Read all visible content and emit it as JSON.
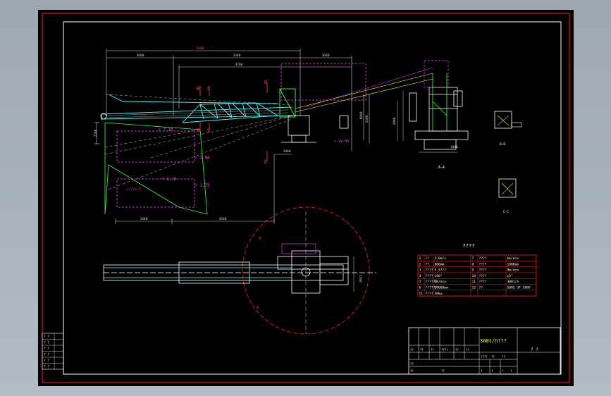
{
  "colors": {
    "frame": "#ff2020",
    "outline": "#ffffff",
    "structure": "#40ffff",
    "dimension": "#d0d0d0",
    "zone_magenta": "#ff40ff",
    "zone_green": "#40ff40",
    "annotation": "#ffff00",
    "table_text": "#ffffff"
  },
  "side_view": {
    "dims": {
      "total_top": "5800",
      "left_top": "3000",
      "mid_top": "3300",
      "right_top": "3000",
      "inner": "4700",
      "base_left": "3400",
      "base_right": "4500",
      "small_right": "1000",
      "vertical_left": "2500",
      "vertical_mid": "8000",
      "vertical_right": "1500"
    },
    "section_marks": {
      "b1": "B",
      "c1": "C",
      "d1": "D",
      "b2": "B",
      "c2": "C",
      "d2": "D"
    },
    "levels": {
      "l1": "▽ 7.10",
      "l2": "▽ 3.90",
      "l3": "▽ 3.10",
      "l4": "▽ 1.75",
      "l5": "▽ +9.00"
    },
    "hatch_label": "/////////"
  },
  "end_view": {
    "caption": "A-A",
    "dim_vertical": "4800",
    "dim_bottom": "3000"
  },
  "detail_views": {
    "bb_label": "B-B",
    "cc_label": "C-C"
  },
  "plan_view": {
    "dim_right": "1500",
    "tag_a": "A",
    "tag_b": "A"
  },
  "spec_table": {
    "title": "????",
    "rows": [
      [
        "1",
        "??",
        "2.0m/s",
        "7",
        "????",
        "km/min"
      ],
      [
        "2",
        "??",
        "800mm",
        "8",
        "????",
        "1000mm"
      ],
      [
        "3",
        "????",
        "5.5?/?",
        "9",
        "????",
        "4m/min"
      ],
      [
        "4",
        "????",
        "±90°",
        "10",
        "????",
        "±5°"
      ],
      [
        "5",
        "??????",
        "6m/min",
        "11",
        "????",
        "3001/h"
      ],
      [
        "6",
        "??????",
        "24000mm",
        "12",
        "??",
        "50HZ 3F 380V"
      ],
      [
        "11",
        "????",
        "30kw",
        "",
        "",
        ""
      ]
    ]
  },
  "title_block": {
    "project": "300t/h???",
    "sub_a": "? ?",
    "row_labels": [
      "??",
      "??",
      "??",
      "????",
      "??",
      "??"
    ],
    "sign_labels": [
      "??",
      "??",
      "??"
    ],
    "mid_labels": [
      "????",
      "??",
      "??"
    ],
    "sheet_labels": [
      "?",
      "?",
      "?",
      "?"
    ]
  },
  "revision_table": {
    "rows": [
      "? ?",
      "? ?",
      "? ?",
      "? ?",
      "? ?",
      "? ?"
    ]
  }
}
